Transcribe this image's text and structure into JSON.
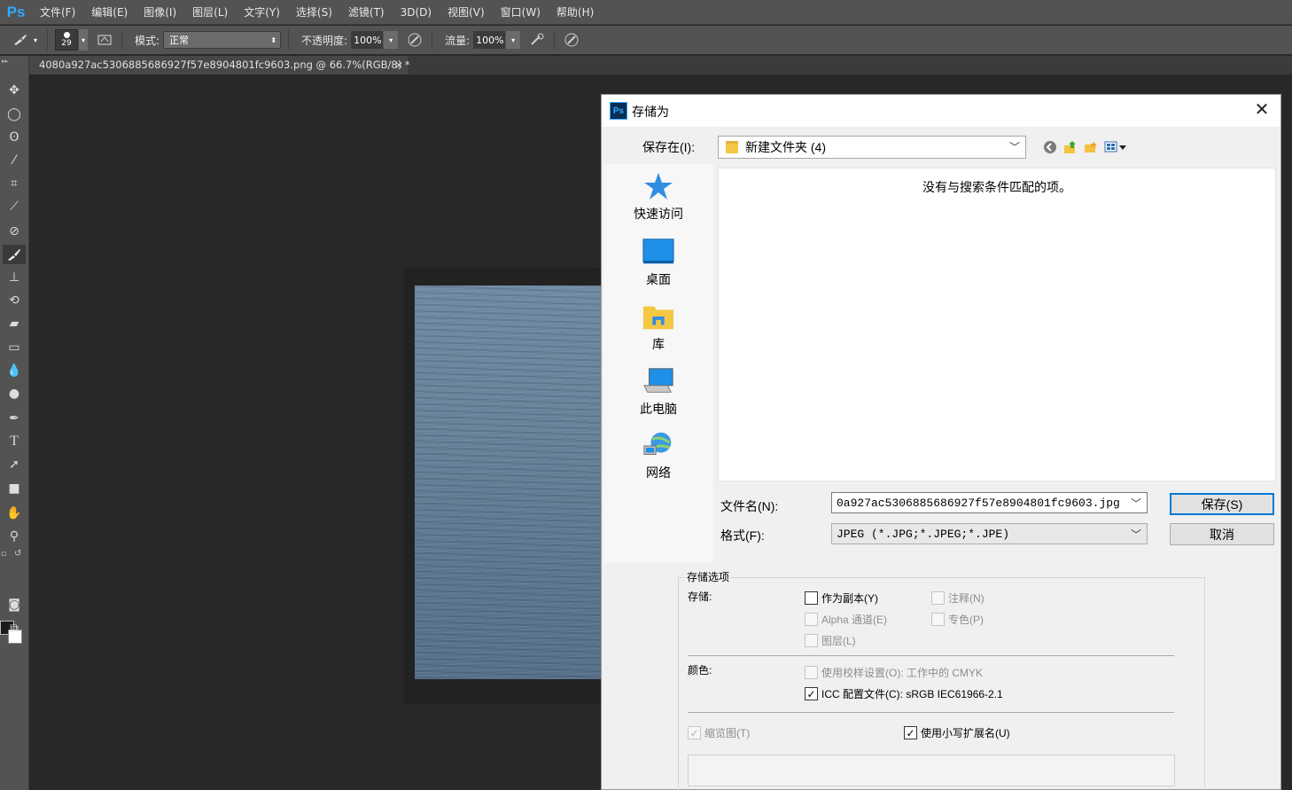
{
  "app": {
    "logo": "Ps",
    "menu": [
      "文件(F)",
      "编辑(E)",
      "图像(I)",
      "图层(L)",
      "文字(Y)",
      "选择(S)",
      "滤镜(T)",
      "3D(D)",
      "视图(V)",
      "窗口(W)",
      "帮助(H)"
    ]
  },
  "options": {
    "brush_size": "29",
    "mode_label": "模式:",
    "mode_value": "正常",
    "opacity_label": "不透明度:",
    "opacity_value": "100%",
    "flow_label": "流量:",
    "flow_value": "100%"
  },
  "document": {
    "tab_title": "4080a927ac5306885686927f57e8904801fc9603.png @ 66.7%(RGB/8) *",
    "tab_close": "×"
  },
  "tools": [
    "move-icon",
    "marquee-icon",
    "lasso-icon",
    "quick-select-icon",
    "crop-icon",
    "eyedropper-icon",
    "healing-icon",
    "brush-icon",
    "stamp-icon",
    "history-brush-icon",
    "eraser-icon",
    "gradient-icon",
    "blur-icon",
    "dodge-icon",
    "pen-icon",
    "type-icon",
    "path-select-icon",
    "rectangle-icon",
    "hand-icon",
    "zoom-icon"
  ],
  "dialog": {
    "icon": "Ps",
    "title": "存储为",
    "close": "✕",
    "save_in_label": "保存在(I):",
    "save_in_value": "新建文件夹 (4)",
    "places": [
      {
        "label": "快速访问",
        "icon": "star-icon"
      },
      {
        "label": "桌面",
        "icon": "desktop-icon"
      },
      {
        "label": "库",
        "icon": "library-icon"
      },
      {
        "label": "此电脑",
        "icon": "computer-icon"
      },
      {
        "label": "网络",
        "icon": "network-icon"
      }
    ],
    "empty_message": "没有与搜索条件匹配的项。",
    "filename_label": "文件名(N):",
    "filename_value": "0a927ac5306885686927f57e8904801fc9603.jpg",
    "format_label": "格式(F):",
    "format_value": "JPEG (*.JPG;*.JPEG;*.JPE)",
    "save_button": "保存(S)",
    "cancel_button": "取消",
    "options": {
      "group_title": "存储选项",
      "save_label": "存储:",
      "as_copy": "作为副本(Y)",
      "notes": "注释(N)",
      "alpha": "Alpha 通道(E)",
      "spot": "专色(P)",
      "layers": "图层(L)",
      "color_label": "颜色:",
      "proof_setup": "使用校样设置(O): 工作中的 CMYK",
      "icc_profile": "ICC 配置文件(C):  sRGB IEC61966-2.1",
      "thumbnail": "缩览图(T)",
      "lowercase_ext": "使用小写扩展名(U)"
    }
  }
}
